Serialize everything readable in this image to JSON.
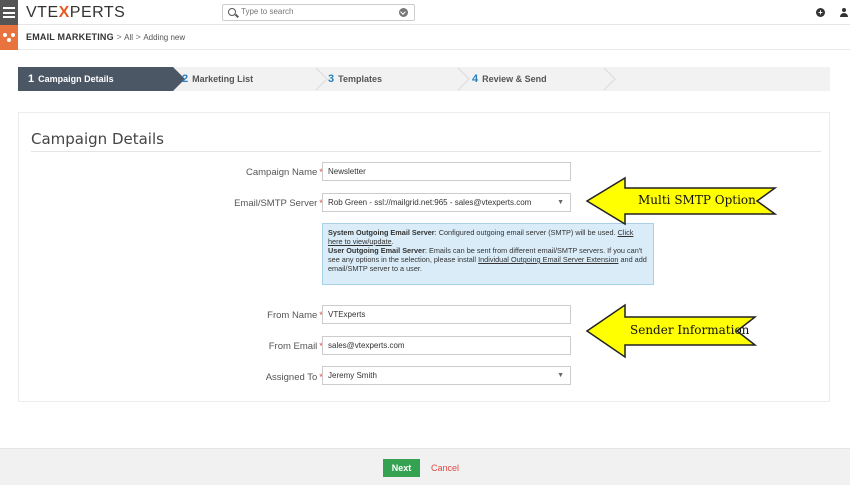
{
  "topbar": {
    "logo_prefix": "VTE",
    "logo_x": "X",
    "logo_suffix": "PERTS",
    "search_placeholder": "Type to search",
    "plus_icon": "plus-circle-icon",
    "user_icon": "user-icon"
  },
  "breadcrumb": {
    "module": "EMAIL MARKETING",
    "sep1": ">",
    "all": "All",
    "sep2": ">",
    "current": "Adding new"
  },
  "steps": [
    {
      "num": "1",
      "label": "Campaign Details"
    },
    {
      "num": "2",
      "label": "Marketing List"
    },
    {
      "num": "3",
      "label": "Templates"
    },
    {
      "num": "4",
      "label": "Review & Send"
    }
  ],
  "form": {
    "title": "Campaign Details",
    "required_mark": "*",
    "campaign_name": {
      "label": "Campaign Name",
      "value": "Newsletter"
    },
    "smtp_server": {
      "label": "Email/SMTP Server",
      "value": "Rob Green - ssl://mailgrid.net:965 - sales@vtexperts.com"
    },
    "from_name": {
      "label": "From Name",
      "value": "VTExperts"
    },
    "from_email": {
      "label": "From Email",
      "value": "sales@vtexperts.com"
    },
    "assigned_to": {
      "label": "Assigned To",
      "value": "Jeremy Smith"
    }
  },
  "info": {
    "sys_title": "System Outgoing Email Server",
    "sys_text": ": Configured outgoing email server (SMTP) will be used. ",
    "sys_link": "Click here to view/update",
    "sys_end": ".",
    "user_title": "User Outgoing Email Server",
    "user_text": ": Emails can be sent from different email/SMTP servers. If you can't see any options in the selection, please install ",
    "user_link": "Individual Outgoing Email Server Extension",
    "user_end": " and add email/SMTP server to a user."
  },
  "callouts": {
    "smtp": "Multi SMTP Option",
    "sender": "Sender Information"
  },
  "footer": {
    "next": "Next",
    "cancel": "Cancel"
  },
  "colors": {
    "accent_orange": "#e8733e",
    "step_active": "#4c5766",
    "next_green": "#35a251",
    "cancel_red": "#e04848",
    "callout_yellow": "#ffff00"
  }
}
